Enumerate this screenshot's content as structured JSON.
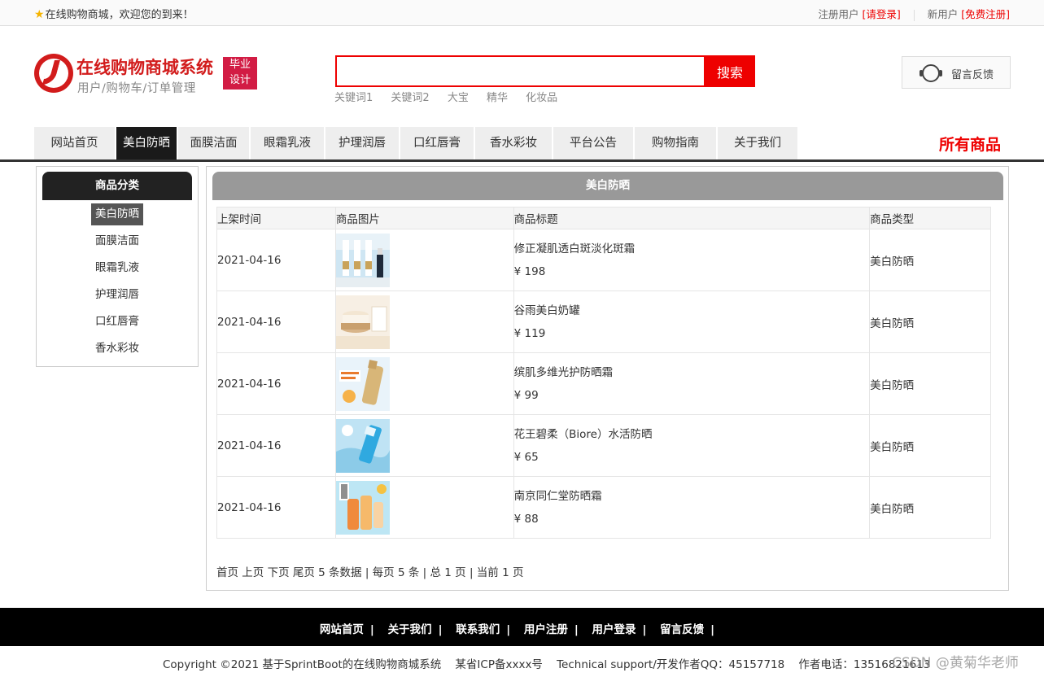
{
  "topbar": {
    "welcome": "在线购物商城，欢迎您的到来！",
    "register_user_label": "注册用户",
    "login_link": "[请登录]",
    "new_user_label": "新用户",
    "signup_link": "[免费注册]"
  },
  "logo": {
    "title": "在线购物商城系统",
    "subtitle": "用户/购物车/订单管理",
    "badge_line1": "毕业",
    "badge_line2": "设计"
  },
  "search": {
    "value": "",
    "button": "搜索",
    "keywords": [
      "关键词1",
      "关键词2",
      "大宝",
      "精华",
      "化妆品"
    ]
  },
  "feedback_label": "留言反馈",
  "nav": {
    "items": [
      "网站首页",
      "美白防晒",
      "面膜洁面",
      "眼霜乳液",
      "护理润唇",
      "口红唇膏",
      "香水彩妆",
      "平台公告",
      "购物指南",
      "关于我们"
    ],
    "active_index": 1,
    "all_goods": "所有商品"
  },
  "sidebar": {
    "title": "商品分类",
    "categories": [
      "美白防晒",
      "面膜洁面",
      "眼霜乳液",
      "护理润唇",
      "口红唇膏",
      "香水彩妆"
    ]
  },
  "main": {
    "title": "美白防晒",
    "columns": [
      "上架时间",
      "商品图片",
      "商品标题",
      "商品类型"
    ],
    "rows": [
      {
        "date": "2021-04-16",
        "title": "修正凝肌透白斑淡化斑霜",
        "price": "¥ 198",
        "type": "美白防晒"
      },
      {
        "date": "2021-04-16",
        "title": "谷雨美白奶罐",
        "price": "¥ 119",
        "type": "美白防晒"
      },
      {
        "date": "2021-04-16",
        "title": "缤肌多维光护防晒霜",
        "price": "¥ 99",
        "type": "美白防晒"
      },
      {
        "date": "2021-04-16",
        "title": "花王碧柔（Biore）水活防晒",
        "price": "¥ 65",
        "type": "美白防晒"
      },
      {
        "date": "2021-04-16",
        "title": "南京同仁堂防晒霜",
        "price": "¥ 88",
        "type": "美白防晒"
      }
    ],
    "pager": "首页 上页 下页 尾页 5 条数据 | 每页 5 条 | 总 1 页 | 当前 1 页"
  },
  "footer": {
    "links": [
      "网站首页",
      "关于我们",
      "联系我们",
      "用户注册",
      "用户登录",
      "留言反馈"
    ],
    "copyright": "Copyright ©2021 基于SprintBoot的在线购物商城系统    某省ICP备xxxx号    Technical support/开发作者QQ：45157718    作者电话：13516821613",
    "watermark": "CSDN @黄菊华老师"
  },
  "colors": {
    "accent": "#ee0000",
    "nav_active": "#1a1a1a"
  }
}
